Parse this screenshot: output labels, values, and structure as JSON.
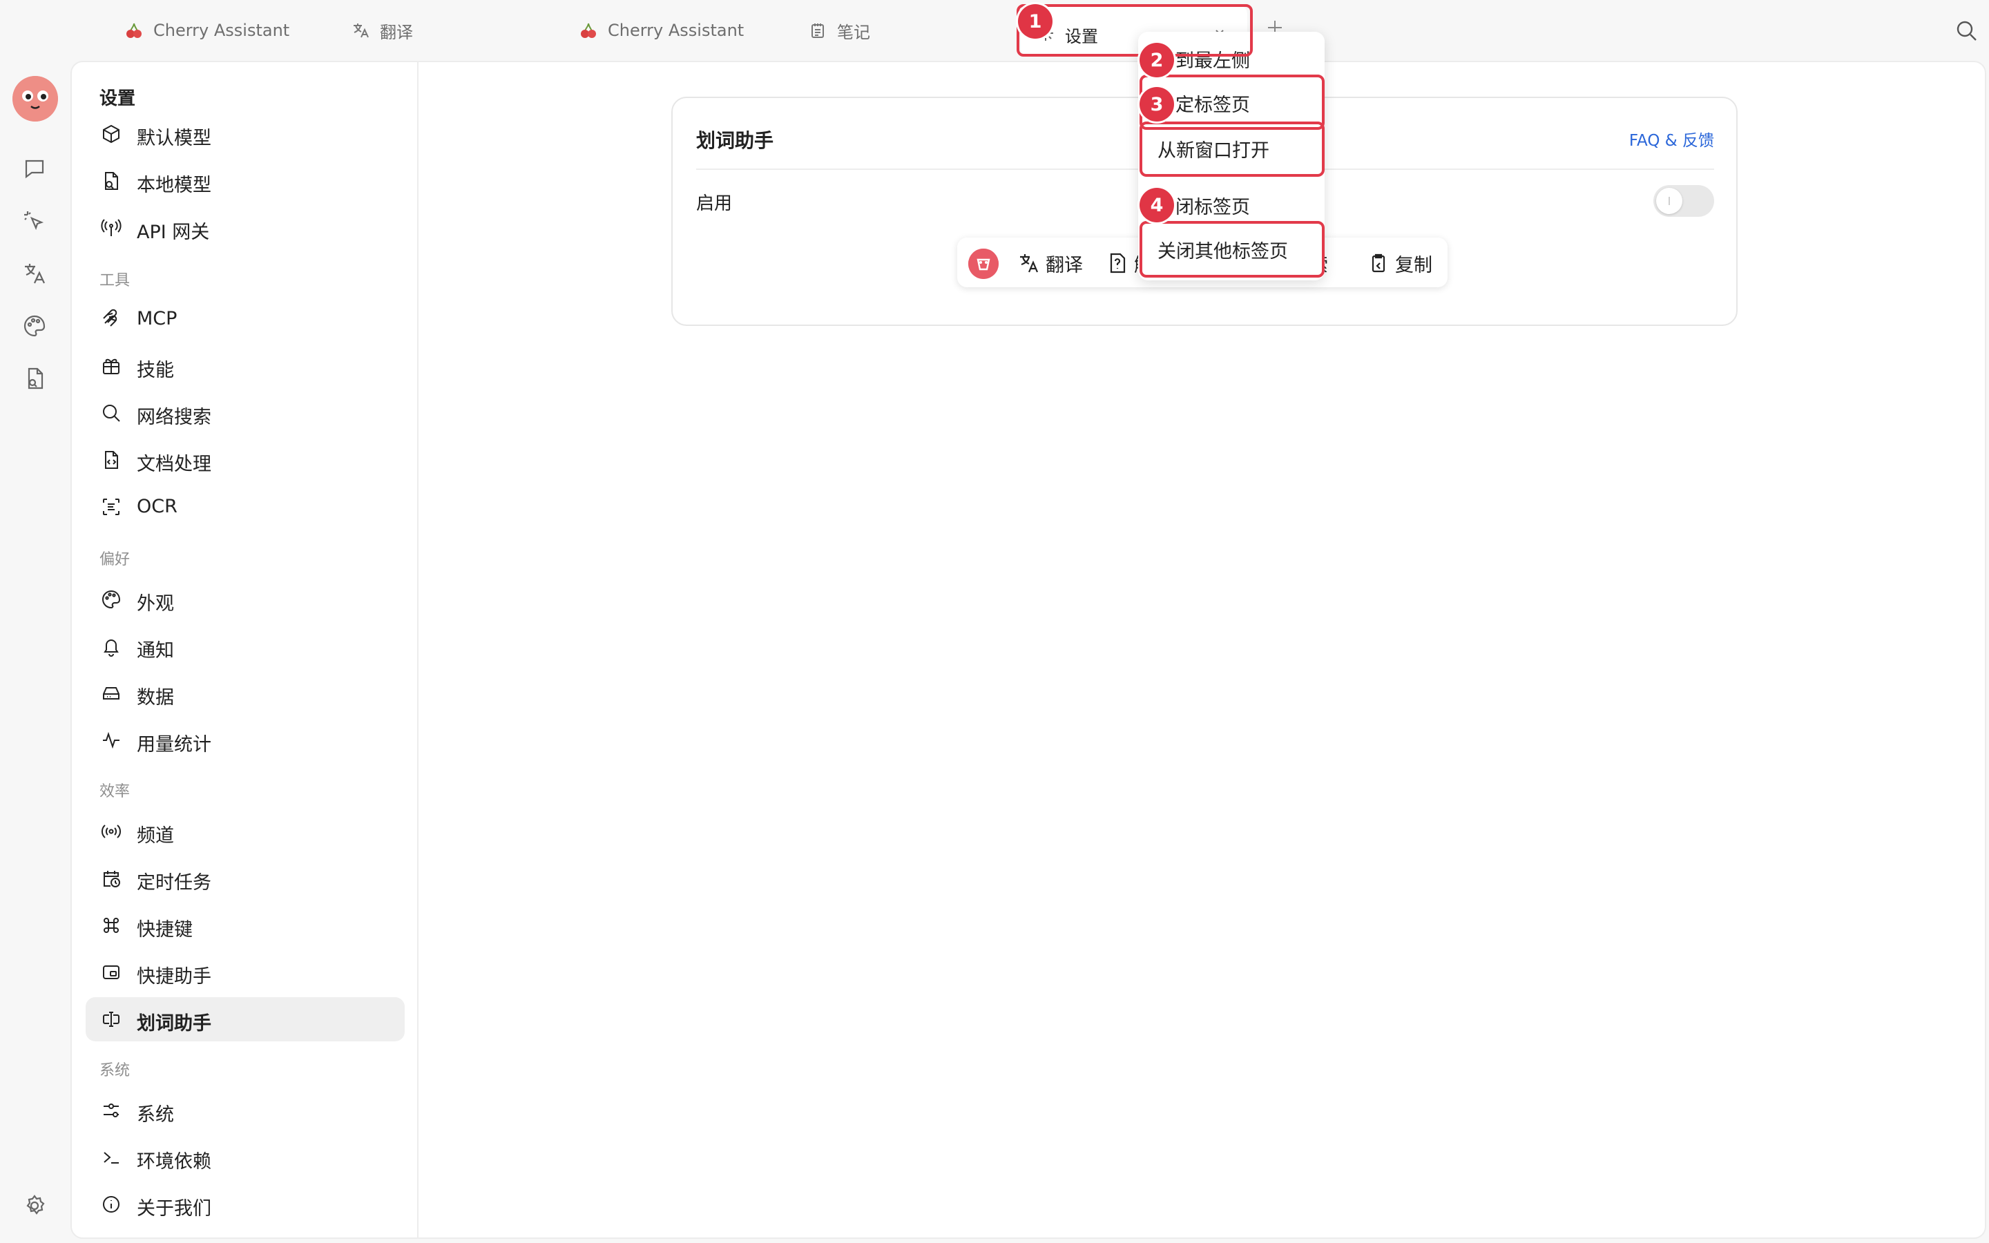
{
  "tabs": [
    {
      "label": "Cherry Assistant",
      "icon": "cherry-icon"
    },
    {
      "label": "翻译",
      "icon": "translate-icon"
    },
    {
      "label": "Cherry Assistant",
      "icon": "cherry-icon"
    },
    {
      "label": "笔记",
      "icon": "notepad-icon"
    }
  ],
  "active_tab": {
    "label": "设置",
    "icon": "gear-icon"
  },
  "context_menu": {
    "items": [
      "到最左侧",
      "定标签页",
      "从新窗口打开",
      "闭标签页",
      "关闭其他标签页"
    ]
  },
  "annotations": [
    "1",
    "2",
    "3",
    "4"
  ],
  "settings_nav": {
    "title": "设置",
    "groups": [
      {
        "title": "",
        "items": [
          {
            "label": "默认模型",
            "icon": "cube-icon"
          },
          {
            "label": "本地模型",
            "icon": "file-search-icon"
          },
          {
            "label": "API 网关",
            "icon": "antenna-icon"
          }
        ]
      },
      {
        "title": "工具",
        "items": [
          {
            "label": "MCP",
            "icon": "mcp-icon"
          },
          {
            "label": "技能",
            "icon": "gift-box-icon"
          },
          {
            "label": "网络搜索",
            "icon": "search-icon"
          },
          {
            "label": "文档处理",
            "icon": "code-file-icon"
          },
          {
            "label": "OCR",
            "icon": "scan-text-icon"
          }
        ]
      },
      {
        "title": "偏好",
        "items": [
          {
            "label": "外观",
            "icon": "palette-icon"
          },
          {
            "label": "通知",
            "icon": "bell-icon"
          },
          {
            "label": "数据",
            "icon": "hard-drive-icon"
          },
          {
            "label": "用量统计",
            "icon": "activity-icon"
          }
        ]
      },
      {
        "title": "效率",
        "items": [
          {
            "label": "频道",
            "icon": "radio-icon"
          },
          {
            "label": "定时任务",
            "icon": "calendar-clock-icon"
          },
          {
            "label": "快捷键",
            "icon": "command-icon"
          },
          {
            "label": "快捷助手",
            "icon": "window-icon"
          },
          {
            "label": "划词助手",
            "icon": "text-cursor-icon",
            "selected": true
          }
        ]
      },
      {
        "title": "系统",
        "items": [
          {
            "label": "系统",
            "icon": "sliders-icon"
          },
          {
            "label": "环境依赖",
            "icon": "terminal-icon"
          },
          {
            "label": "关于我们",
            "icon": "info-icon"
          }
        ]
      }
    ]
  },
  "card": {
    "title": "划词助手",
    "faq_link": "FAQ & 反馈",
    "enable_label": "启用",
    "enabled": false
  },
  "preview_toolbar": {
    "items": [
      {
        "label": "翻译",
        "icon": "translate-icon"
      },
      {
        "label": "解",
        "icon": "question-file-icon"
      },
      {
        "label": "索",
        "icon": "search-icon"
      },
      {
        "label": "复制",
        "icon": "copy-icon"
      }
    ]
  },
  "rail": {
    "icons": [
      "chat-icon",
      "sparkle-pointer-icon",
      "translate-icon",
      "palette-icon",
      "file-search-icon",
      "settings-icon"
    ]
  }
}
